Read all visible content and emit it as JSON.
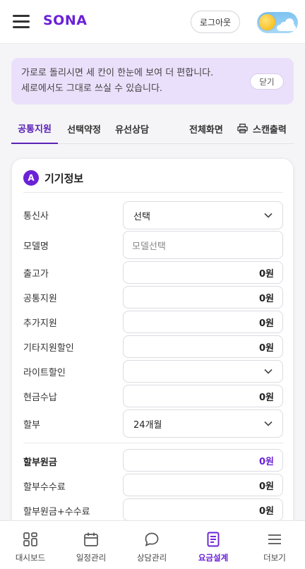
{
  "header": {
    "brand": "SONA",
    "logout_label": "로그아웃"
  },
  "notice": {
    "line1": "가로로 돌리시면 세 칸이 한눈에 보여 더 편합니다.",
    "line2": "세로에서도 그대로 쓰실 수 있습니다.",
    "close_label": "닫기"
  },
  "tabs": {
    "items": [
      {
        "label": "공통지원",
        "active": true
      },
      {
        "label": "선택약정",
        "active": false
      },
      {
        "label": "유선상담",
        "active": false
      }
    ],
    "fullscreen_label": "전체화면",
    "print_label": "스캔출력"
  },
  "device_section": {
    "badge": "A",
    "title": "기기정보",
    "rows": {
      "carrier": {
        "label": "통신사",
        "value": "선택"
      },
      "model": {
        "label": "모델명",
        "placeholder": "모델선택"
      },
      "release_price": {
        "label": "출고가",
        "value": "0원"
      },
      "common_support": {
        "label": "공통지원",
        "value": "0원"
      },
      "extra_support": {
        "label": "추가지원",
        "value": "0원"
      },
      "other_discount": {
        "label": "기타지원할인",
        "value": "0원"
      },
      "light_discount": {
        "label": "라이트할인",
        "value": ""
      },
      "cash_payment": {
        "label": "현금수납",
        "value": "0원"
      },
      "installment": {
        "label": "할부",
        "value": "24개월"
      },
      "principal": {
        "label": "할부원금",
        "value": "0원"
      },
      "fee": {
        "label": "할부수수료",
        "value": "0원"
      },
      "principal_plus_fee": {
        "label": "할부원금+수수료",
        "value": "0원"
      }
    }
  },
  "bottom_nav": {
    "items": [
      {
        "label": "대시보드",
        "icon": "dashboard-icon"
      },
      {
        "label": "일정관리",
        "icon": "calendar-icon"
      },
      {
        "label": "상담관리",
        "icon": "chat-bubble-icon"
      },
      {
        "label": "요금설계",
        "icon": "document-icon",
        "active": true
      },
      {
        "label": "더보기",
        "icon": "menu-icon"
      }
    ]
  },
  "colors": {
    "accent": "#6b21d6",
    "notice_bg": "#ebe0fb"
  }
}
